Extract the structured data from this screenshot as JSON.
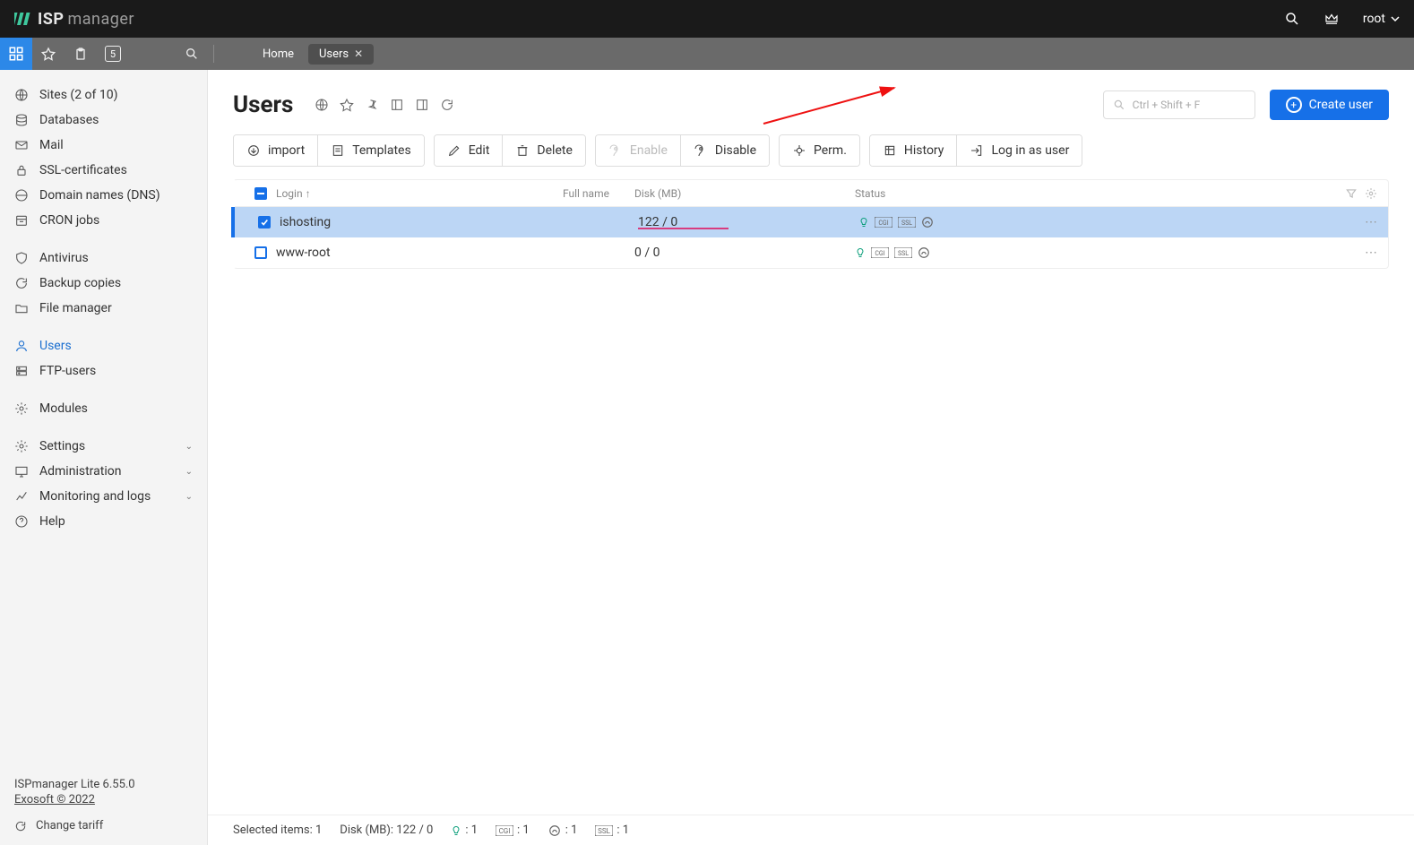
{
  "logo": {
    "part1": "ISP",
    "part2": "manager"
  },
  "topbar": {
    "user": "root"
  },
  "subnav": {
    "badge": "5",
    "tabs": [
      {
        "label": "Home"
      },
      {
        "label": "Users"
      }
    ]
  },
  "sidebar": {
    "items": [
      {
        "icon": "globe",
        "label": "Sites (2 of 10)"
      },
      {
        "icon": "db",
        "label": "Databases"
      },
      {
        "icon": "mail",
        "label": "Mail"
      },
      {
        "icon": "lock",
        "label": "SSL-certificates"
      },
      {
        "icon": "globe2",
        "label": "Domain names (DNS)"
      },
      {
        "icon": "cal",
        "label": "CRON jobs"
      },
      {
        "spacer": true
      },
      {
        "icon": "shield",
        "label": "Antivirus"
      },
      {
        "icon": "refresh",
        "label": "Backup copies"
      },
      {
        "icon": "folder",
        "label": "File manager"
      },
      {
        "spacer": true
      },
      {
        "icon": "user",
        "label": "Users",
        "active": true
      },
      {
        "icon": "server",
        "label": "FTP-users"
      },
      {
        "spacer": true
      },
      {
        "icon": "puzzle",
        "label": "Modules"
      },
      {
        "spacer": true
      },
      {
        "icon": "gear",
        "label": "Settings",
        "chevron": true
      },
      {
        "icon": "desktop",
        "label": "Administration",
        "chevron": true
      },
      {
        "icon": "chart",
        "label": "Monitoring and logs",
        "chevron": true
      },
      {
        "icon": "help",
        "label": "Help"
      }
    ],
    "footer": {
      "line1": "ISPmanager Lite 6.55.0",
      "line2": "Exosoft © 2022",
      "tariff": "Change tariff"
    }
  },
  "page": {
    "title": "Users",
    "filter_placeholder": "Ctrl + Shift + F",
    "create_label": "Create user"
  },
  "toolbar": {
    "import": "import",
    "templates": "Templates",
    "edit": "Edit",
    "delete": "Delete",
    "enable": "Enable",
    "disable": "Disable",
    "perm": "Perm.",
    "history": "History",
    "login_as": "Log in as user"
  },
  "table": {
    "cols": {
      "login": "Login ↑",
      "fullname": "Full name",
      "disk": "Disk (MB)",
      "status": "Status"
    },
    "rows": [
      {
        "login": "ishosting",
        "fullname": "",
        "disk": "122 / 0",
        "selected": true,
        "barWidthPx": 101
      },
      {
        "login": "www-root",
        "fullname": "",
        "disk": "0 / 0",
        "selected": false
      }
    ]
  },
  "statusbar": {
    "selected": "Selected items: 1",
    "disk": "Disk (MB): 122 / 0",
    "bulb": ": 1",
    "cgi": ": 1",
    "php": ": 1",
    "ssl": ": 1"
  }
}
